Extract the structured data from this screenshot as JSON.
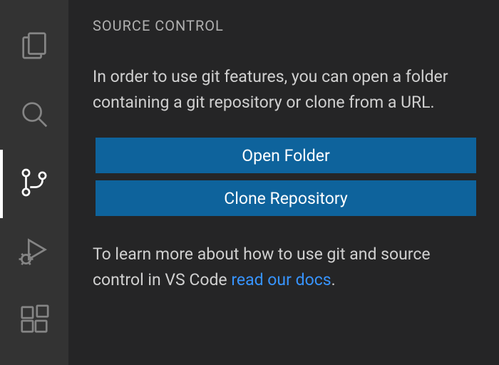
{
  "sidebar": {
    "items": [
      {
        "name": "explorer",
        "active": false
      },
      {
        "name": "search",
        "active": false
      },
      {
        "name": "source-control",
        "active": true
      },
      {
        "name": "run-and-debug",
        "active": false
      },
      {
        "name": "extensions",
        "active": false
      }
    ]
  },
  "panel": {
    "title": "SOURCE CONTROL",
    "intro": "In order to use git features, you can open a folder containing a git repository or clone from a URL.",
    "buttons": {
      "open_folder": "Open Folder",
      "clone_repo": "Clone Repository"
    },
    "learn_prefix": "To learn more about how to use git and source control in VS Code ",
    "learn_link": "read our docs",
    "learn_suffix": "."
  }
}
